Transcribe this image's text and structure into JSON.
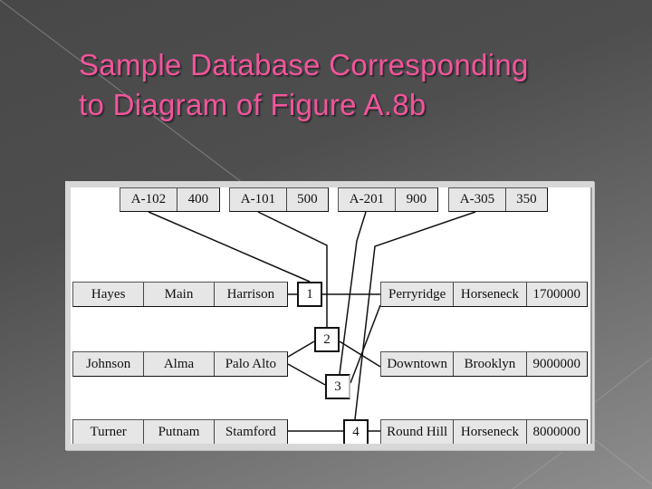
{
  "slide": {
    "title_line1": "Sample Database Corresponding",
    "title_line2": "to Diagram of Figure A.8b",
    "title_color": "#f2559c"
  },
  "diagram": {
    "accounts": [
      {
        "account_number": "A-102",
        "balance": "400"
      },
      {
        "account_number": "A-101",
        "balance": "500"
      },
      {
        "account_number": "A-201",
        "balance": "900"
      },
      {
        "account_number": "A-305",
        "balance": "350"
      }
    ],
    "customers": [
      {
        "name": "Hayes",
        "street": "Main",
        "city": "Harrison"
      },
      {
        "name": "Johnson",
        "street": "Alma",
        "city": "Palo Alto"
      },
      {
        "name": "Turner",
        "street": "Putnam",
        "city": "Stamford"
      }
    ],
    "branches": [
      {
        "name": "Perryridge",
        "city": "Horseneck",
        "assets": "1700000"
      },
      {
        "name": "Downtown",
        "city": "Brooklyn",
        "assets": "9000000"
      },
      {
        "name": "Round Hill",
        "city": "Horseneck",
        "assets": "8000000"
      }
    ],
    "links": [
      {
        "label": "1"
      },
      {
        "label": "2"
      },
      {
        "label": "3"
      },
      {
        "label": "4"
      }
    ]
  }
}
